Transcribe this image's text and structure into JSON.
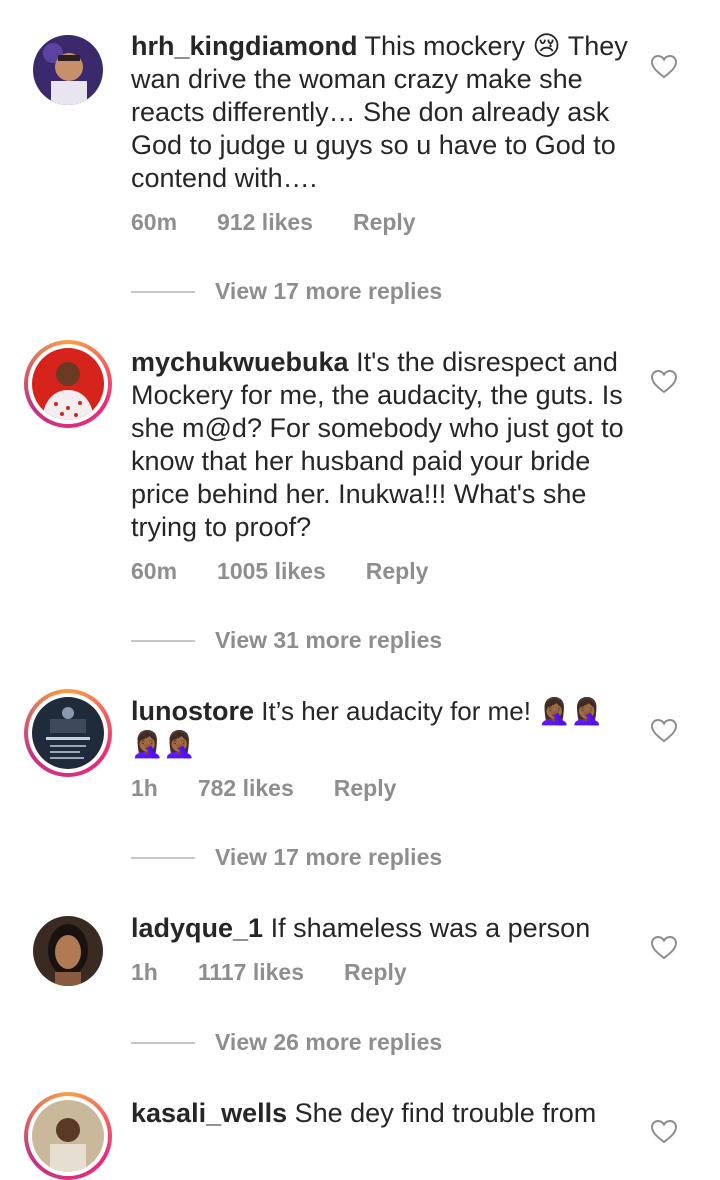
{
  "comments": [
    {
      "username": "hrh_kingdiamond",
      "text": " This mockery 😢 They wan drive the woman crazy make she reacts differently… She don already ask God to judge u guys so u have to God to contend with….",
      "time": "60m",
      "likes": "912 likes",
      "reply": "Reply",
      "view_replies": "View 17 more replies",
      "avatar_ring": false
    },
    {
      "username": "mychukwuebuka",
      "text": " It's the disrespect and Mockery for me, the audacity, the guts. Is she m@d? For somebody who just got to know that her husband paid your bride price behind her.  Inukwa!!! What's she trying to proof?",
      "time": "60m",
      "likes": "1005 likes",
      "reply": "Reply",
      "view_replies": "View 31 more replies",
      "avatar_ring": true
    },
    {
      "username": "lunostore",
      "text": " It’s her audacity for me! 🤦🏾‍♀️🤦🏾‍♀️🤦🏾‍♀️🤦🏾‍♀️",
      "time": "1h",
      "likes": "782 likes",
      "reply": "Reply",
      "view_replies": "View 17 more replies",
      "avatar_ring": true
    },
    {
      "username": "ladyque_1",
      "text": " If shameless was a person",
      "time": "1h",
      "likes": "1117 likes",
      "reply": "Reply",
      "view_replies": "View 26 more replies",
      "avatar_ring": false
    },
    {
      "username": "kasali_wells",
      "text": " She dey find trouble from",
      "avatar_ring": true
    }
  ]
}
